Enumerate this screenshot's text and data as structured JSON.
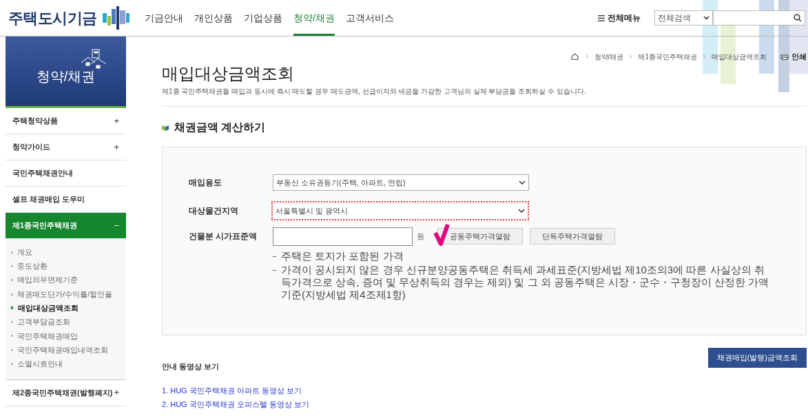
{
  "header": {
    "logo": "주택도시기금",
    "nav": [
      {
        "label": "기금안내",
        "selected": false
      },
      {
        "label": "개인상품",
        "selected": false
      },
      {
        "label": "기업상품",
        "selected": false
      },
      {
        "label": "청약/채권",
        "selected": true
      },
      {
        "label": "고객서비스",
        "selected": false
      }
    ],
    "all_menu": "전체메뉴",
    "search_scope": "전체검색"
  },
  "sidebar": {
    "title": "청약/채권",
    "items": [
      {
        "label": "주택청약상품",
        "expanded": false,
        "toggle": "+"
      },
      {
        "label": "청약가이드",
        "expanded": false,
        "toggle": "+"
      },
      {
        "label": "국민주택채권안내",
        "expanded": false
      },
      {
        "label": "셀프 채권매입 도우미",
        "expanded": false
      },
      {
        "label": "제1종국민주택채권",
        "expanded": true,
        "toggle": "−",
        "children": [
          {
            "label": "개요",
            "selected": false
          },
          {
            "label": "중도상환",
            "selected": false
          },
          {
            "label": "매입의무면제기준",
            "selected": false
          },
          {
            "label": "채권매도단가/수익률/할인율",
            "selected": false
          },
          {
            "label": "매입대상금액조회",
            "selected": true
          },
          {
            "label": "고객부담금조회",
            "selected": false
          },
          {
            "label": "국민주택채권매입",
            "selected": false
          },
          {
            "label": "국민주택채권매입내역조회",
            "selected": false
          },
          {
            "label": "소멸시효안내",
            "selected": false
          }
        ]
      },
      {
        "label": "제2종국민주택채권(발행폐지)",
        "expanded": false,
        "toggle": "+"
      }
    ]
  },
  "breadcrumb": [
    "청약/채권",
    "제1종국민주택채권",
    "매입대상금액조회"
  ],
  "print": "인쇄",
  "page_title": "매입대상금액조회",
  "description": "제1종 국민주택채권을 매입과 동시에 즉시 매도할 경우 매도금액, 선급이자와 세금을 가감한 고객님의 실제 부담금을 조회하실 수 있습니다.",
  "section_title": "채권금액 계산하기",
  "form": {
    "purpose_label": "매입용도",
    "purpose_value": "부동산 소유권등기(주택, 아파트, 연립)",
    "region_label": "대상물건지역",
    "region_value": "서울특별시 및 광역시",
    "price_label": "건물분 시가표준액",
    "unit": "원",
    "buttons": [
      "공동주택가격열람",
      "단독주택가격열람"
    ],
    "notes": [
      "주택은 토지가 포함된 가격",
      "가격이 공시되지 않은 경우 신규분양공동주택은 취득세 과세표준(지방세법 제10조의3에 따른 사실상의 취득가격으로 상속, 증여 및 무상취득의 경우는 제외) 및 그 외 공동주택은 시장・군수・구청장이 산정한 가액 기준(지방세법 제4조제1항)"
    ]
  },
  "submit": "채권매입(발행)금액조회",
  "video_title": "안내 동영상 보기",
  "video_links": [
    "1. HUG 국민주택채권 아파트 동영상 보기",
    "2. HUG 국민주택채권 오피스텔 동영상 보기"
  ]
}
